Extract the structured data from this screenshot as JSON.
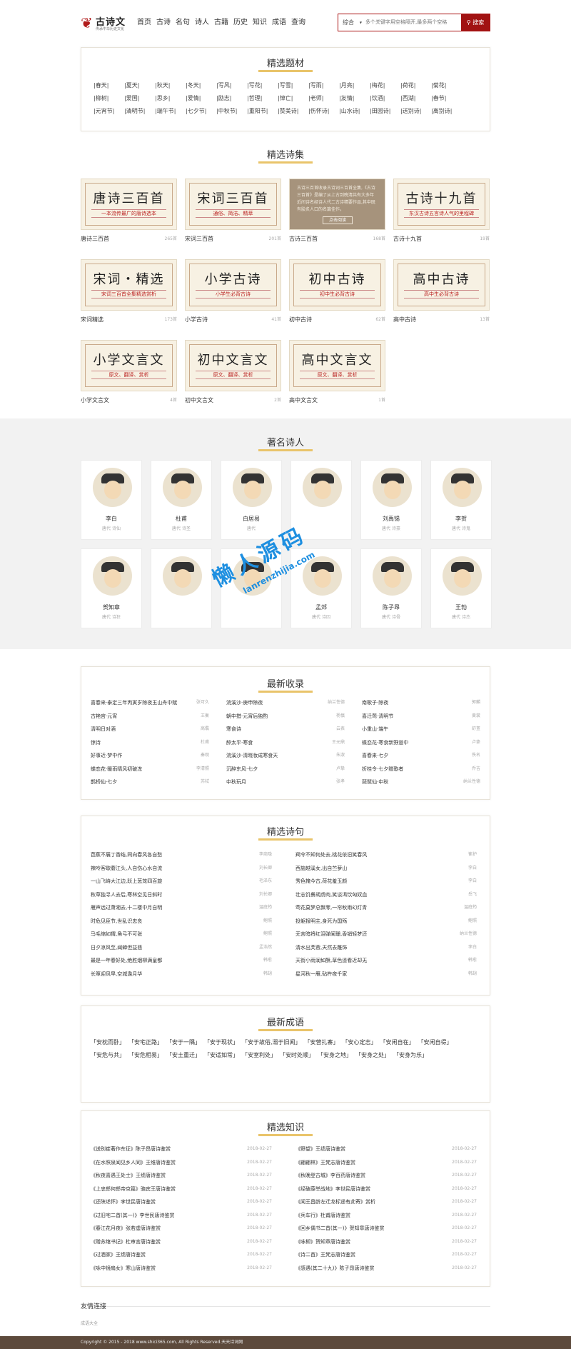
{
  "header": {
    "logo_name": "古诗文",
    "logo_slogan": "传承中华历史文化",
    "nav": [
      "首页",
      "古诗",
      "名句",
      "诗人",
      "古籍",
      "历史",
      "知识",
      "成语",
      "查询"
    ],
    "search": {
      "select": "综合",
      "placeholder": "多个关键字用空格隔开,最多两个空格",
      "button": "搜索"
    }
  },
  "topics": {
    "title": "精选题材",
    "items": [
      "春天",
      "夏天",
      "秋天",
      "冬天",
      "写风",
      "写花",
      "写雪",
      "写雨",
      "月亮",
      "梅花",
      "荷花",
      "菊花",
      "柳树",
      "爱国",
      "思乡",
      "爱情",
      "励志",
      "哲理",
      "悼亡",
      "老师",
      "友情",
      "饮酒",
      "西湖",
      "春节",
      "元宵节",
      "清明节",
      "端午节",
      "七夕节",
      "中秋节",
      "重阳节",
      "赞美诗",
      "伤怀诗",
      "山水诗",
      "田园诗",
      "送别诗",
      "离别诗"
    ]
  },
  "collections": {
    "title": "精选诗集",
    "items": [
      {
        "label": "唐诗三百首",
        "count": "265首",
        "t1": "唐诗三百首",
        "t2": "一本流传最广的唐诗选本"
      },
      {
        "label": "宋词三百首",
        "count": "201首",
        "t1": "宋词三百首",
        "t2": "通俗、简洁、精萃"
      },
      {
        "label": "古诗三百首",
        "count": "168首",
        "desc": "古诗三百首收录古诗词三百首全集,《古诗三百首》是编了从上古到晚清共有大多年近间诗名经诗人代二古诗精要作品,其中既有脍炙人口的名篇佳作。",
        "more": "点击阅读"
      },
      {
        "label": "古诗十九首",
        "count": "19首",
        "t1": "古诗十九首",
        "t2": "东汉古诗五言诗人气的里程碑"
      },
      {
        "label": "宋词精选",
        "count": "173首",
        "t1": "宋词・精选",
        "t2": "宋词三百首全集精选赏析"
      },
      {
        "label": "小学古诗",
        "count": "41首",
        "t1": "小学古诗",
        "t2": "小学生必背古诗"
      },
      {
        "label": "初中古诗",
        "count": "62首",
        "t1": "初中古诗",
        "t2": "初中生必背古诗"
      },
      {
        "label": "高中古诗",
        "count": "13首",
        "t1": "高中古诗",
        "t2": "高中生必背古诗"
      },
      {
        "label": "小学文言文",
        "count": "4首",
        "t1": "小学文言文",
        "t2": "原文、翻译、赏析"
      },
      {
        "label": "初中文言文",
        "count": "2首",
        "t1": "初中文言文",
        "t2": "原文、翻译、赏析"
      },
      {
        "label": "高中文言文",
        "count": "1首",
        "t1": "高中文言文",
        "t2": "原文、翻译、赏析"
      }
    ]
  },
  "poets": {
    "title": "著名诗人",
    "items": [
      {
        "name": "李白",
        "dynasty": "唐代 诗仙"
      },
      {
        "name": "杜甫",
        "dynasty": "唐代 诗圣"
      },
      {
        "name": "白居易",
        "dynasty": "唐代"
      },
      {
        "name": "",
        "dynasty": ""
      },
      {
        "name": "刘禹锡",
        "dynasty": "唐代 诗豪"
      },
      {
        "name": "李贺",
        "dynasty": "唐代 诗鬼"
      },
      {
        "name": "",
        "dynasty": "唐"
      },
      {
        "name": "",
        "dynasty": ""
      },
      {
        "name": "",
        "dynasty": ""
      },
      {
        "name": "孟郊",
        "dynasty": "唐代 诗囚"
      },
      {
        "name": "陈子昂",
        "dynasty": "唐代 诗骨"
      },
      {
        "name": "王勃",
        "dynasty": "唐代 诗杰"
      },
      {
        "name": "贺知章",
        "dynasty": "唐代 诗狂"
      }
    ],
    "watermark": "懒人源码",
    "watermark_url": "lanrenzhijia.com"
  },
  "latest": {
    "title": "最新收录",
    "cols": [
      [
        [
          "喜春来·泰定三年丙寅岁除夜玉山舟中赋",
          "张可久"
        ],
        [
          "古艳宫·元宵",
          "王衡"
        ],
        [
          "清明日对酒",
          "高翥"
        ],
        [
          "惊诗",
          "杜甫"
        ],
        [
          "好事近·梦中作",
          "秦观"
        ],
        [
          "蝶恋花·暖雨晴风初破冻",
          "李清照"
        ],
        [
          "鹊桥仙·七夕",
          "苏轼"
        ]
      ],
      [
        [
          "浣溪沙·庚申除夜",
          "纳兰性德"
        ],
        [
          "朝中措·元宵后独酌",
          "杨慎"
        ],
        [
          "寒食诗",
          "云表"
        ],
        [
          "醉太平·寒食",
          "王元鼎"
        ],
        [
          "浣溪沙·清晓妆成寒食天",
          "朱淑"
        ],
        [
          "沉醉东风·七夕",
          "卢挚"
        ],
        [
          "中秋玩月",
          "张孝"
        ]
      ],
      [
        [
          "南歌子·除夜",
          "郭麟"
        ],
        [
          "喜迁莺·清明节",
          "黄裳"
        ],
        [
          "小重山·端午",
          "舒亶"
        ],
        [
          "蝶恋花·寒食新野道中",
          "卢挚"
        ],
        [
          "喜春来·七夕",
          "佚名"
        ],
        [
          "折桂令·七夕赠歌者",
          "乔吉"
        ],
        [
          "琵琶仙·中秋",
          "纳兰性德"
        ]
      ]
    ]
  },
  "sentences": {
    "title": "精选诗句",
    "cols": [
      [
        [
          "芭蕉不展丁香结,同向春风各自愁",
          "李商隐"
        ],
        [
          "辣呤客歇蘑江头,人自伤心水自流",
          "刘长卿"
        ],
        [
          "一山飞峙大江边,跃上葱茏四百旋",
          "毛泽东"
        ],
        [
          "秋草独寻人去后,寒林空见日斜时",
          "刘长卿"
        ],
        [
          "雁声远过萧湘去,十二楼中月自明",
          "温庭筠"
        ],
        [
          "时危见臣节,世乱识忠良",
          "鲍照"
        ],
        [
          "马毛缩如猬,角弓不可张",
          "鲍照"
        ],
        [
          "日夕凉风至,闻蝉但益悲",
          "孟浩然"
        ],
        [
          "最是一年春好处,绝胜烟柳满皇都",
          "韩愈"
        ],
        [
          "长箪迎风早,空城澹月华",
          "韩翃"
        ]
      ],
      [
        [
          "羯令不知何处去,桃花依旧笑春风",
          "崔护"
        ],
        [
          "西施越溪女,出自苎萝山",
          "李白"
        ],
        [
          "秀色掩今古,荷花羞玉颜",
          "李白"
        ],
        [
          "壮志饥餐胡虏肉,笑谈渴饮匈奴血",
          "岳飞"
        ],
        [
          "莺花莫梦总飘零,一帘秋雨幻灯青",
          "温庭筠"
        ],
        [
          "投躯报明主,身死为国殇",
          "鲍照"
        ],
        [
          "无言暗将红泪弹阑珊,香销轻梦还",
          "纳兰性德"
        ],
        [
          "清水出芙蓉,天然去雕饰",
          "李白"
        ],
        [
          "天街小雨润如酥,草色遥看近却无",
          "韩愈"
        ],
        [
          "星河秋一雁,砧杵夜千家",
          "韩翃"
        ]
      ]
    ]
  },
  "idioms": {
    "title": "最新成语",
    "items": [
      "「安枕而卧」",
      "「安宅正路」",
      "「安于一隅」",
      "「安于现状」",
      "「安于故俗,溺于旧闻」",
      "「安营扎寨」",
      "「安心定志」",
      "「安闲自在」",
      "「安闲自得」",
      "「安危与共」",
      "「安危相易」",
      "「安土重迁」",
      "「安适如常」",
      "「安室利处」",
      "「安时处顺」",
      "「安身之地」",
      "「安身之处」",
      "「安身为乐」"
    ]
  },
  "knowledge": {
    "title": "精选知识",
    "cols": [
      [
        [
          "《送别崔著作东征》陈子昂唐诗鉴赏",
          "2018-02-27"
        ],
        [
          "《在水照泉闻见乡人同》王维唐诗鉴赏",
          "2018-02-27"
        ],
        [
          "《秋夜喜遇王处士》王绩唐诗鉴赏",
          "2018-02-27"
        ],
        [
          "《上忠郎何郎帝京篇》骆宾王唐诗鉴赏",
          "2018-02-27"
        ],
        [
          "《还陕述怀》李世民唐诗鉴赏",
          "2018-02-27"
        ],
        [
          "《过旧宅二首(其一)》李世民唐诗鉴赏",
          "2018-02-27"
        ],
        [
          "《春江花月夜》张若虚唐诗鉴赏",
          "2018-02-27"
        ],
        [
          "《赠苏绾书记》杜审言唐诗鉴赏",
          "2018-02-27"
        ],
        [
          "《过酒家》王绩唐诗鉴赏",
          "2018-02-27"
        ],
        [
          "《咏中镜扇女》寒山唐诗鉴赏",
          "2018-02-27"
        ]
      ],
      [
        [
          "《野望》王绩唐诗鉴赏",
          "2018-02-27"
        ],
        [
          "《翩翩林》王梵志唐诗鉴赏",
          "2018-02-27"
        ],
        [
          "《秋晚登古城》李百药唐诗鉴赏",
          "2018-02-27"
        ],
        [
          "《经破薛举战地》李世民唐诗鉴赏",
          "2018-02-27"
        ],
        [
          "《闻王昌龄左迁龙标遥有此寄》赏析",
          "2018-02-27"
        ],
        [
          "《兵车行》杜甫唐诗鉴赏",
          "2018-02-27"
        ],
        [
          "《回乡偶书二首(其一)》贺知章唐诗鉴赏",
          "2018-02-27"
        ],
        [
          "《咏柳》贺知章唐诗鉴赏",
          "2018-02-27"
        ],
        [
          "《诗二首》王梵志唐诗鉴赏",
          "2018-02-27"
        ],
        [
          "《感遇(其二十九)》陈子昂唐诗鉴赏",
          "2018-02-27"
        ]
      ]
    ]
  },
  "footer": {
    "friends_title": "友情连接",
    "friends": [
      "成语大全"
    ],
    "copyright": "Copyright © 2015 - 2018 www.shici365.com, All Rights Reserved.天天诗词网"
  }
}
